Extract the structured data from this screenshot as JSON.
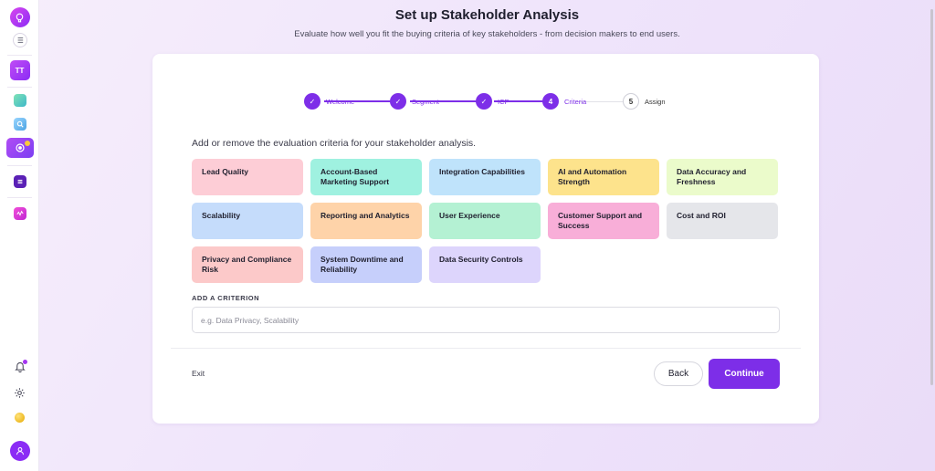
{
  "app": {
    "workspace_initials": "TT",
    "colors": {
      "accent": "#7d2ee8",
      "brand_gradient_start": "#d946ef",
      "brand_gradient_end": "#8b2cf5"
    }
  },
  "sidebar": {
    "icons": [
      "logo-icon",
      "menu-toggle-icon",
      "workspace-avatar",
      "app-icon-green",
      "app-icon-blue",
      "app-icon-active",
      "app-icon-dark-purple",
      "app-icon-pink",
      "bell-icon",
      "gear-icon",
      "coin-icon",
      "user-icon"
    ]
  },
  "header": {
    "title": "Set up Stakeholder Analysis",
    "subtitle": "Evaluate how well you fit the buying criteria of key stakeholders - from decision makers to end users."
  },
  "stepper": {
    "steps": [
      {
        "label": "Welcome",
        "marker": "✓",
        "status": "done"
      },
      {
        "label": "Segment",
        "marker": "✓",
        "status": "done"
      },
      {
        "label": "ICP",
        "marker": "✓",
        "status": "done"
      },
      {
        "label": "Criteria",
        "marker": "4",
        "status": "current"
      },
      {
        "label": "Assign",
        "marker": "5",
        "status": "todo"
      }
    ]
  },
  "main": {
    "instruction": "Add or remove the evaluation criteria for your stakeholder analysis.",
    "criteria": [
      {
        "label": "Lead Quality",
        "color": "#fdcdd6"
      },
      {
        "label": "Account-Based Marketing Support",
        "color": "#9ff1e0"
      },
      {
        "label": "Integration Capabilities",
        "color": "#bfe3fb"
      },
      {
        "label": "AI and Automation Strength",
        "color": "#fde38c"
      },
      {
        "label": "Data Accuracy and Freshness",
        "color": "#ebfbcb"
      },
      {
        "label": "Scalability",
        "color": "#c5dcfb"
      },
      {
        "label": "Reporting and Analytics",
        "color": "#fed3a9"
      },
      {
        "label": "User Experience",
        "color": "#b4f1d3"
      },
      {
        "label": "Customer Support and Success",
        "color": "#f8aed8"
      },
      {
        "label": "Cost and ROI",
        "color": "#e5e6ea"
      },
      {
        "label": "Privacy and Compliance Risk",
        "color": "#fcc9c9"
      },
      {
        "label": "System Downtime and Reliability",
        "color": "#c6cffb"
      },
      {
        "label": "Data Security Controls",
        "color": "#ddd5fc"
      }
    ],
    "add_label": "ADD A CRITERION",
    "add_placeholder": "e.g. Data Privacy, Scalability"
  },
  "footer": {
    "exit_label": "Exit",
    "back_label": "Back",
    "continue_label": "Continue"
  }
}
